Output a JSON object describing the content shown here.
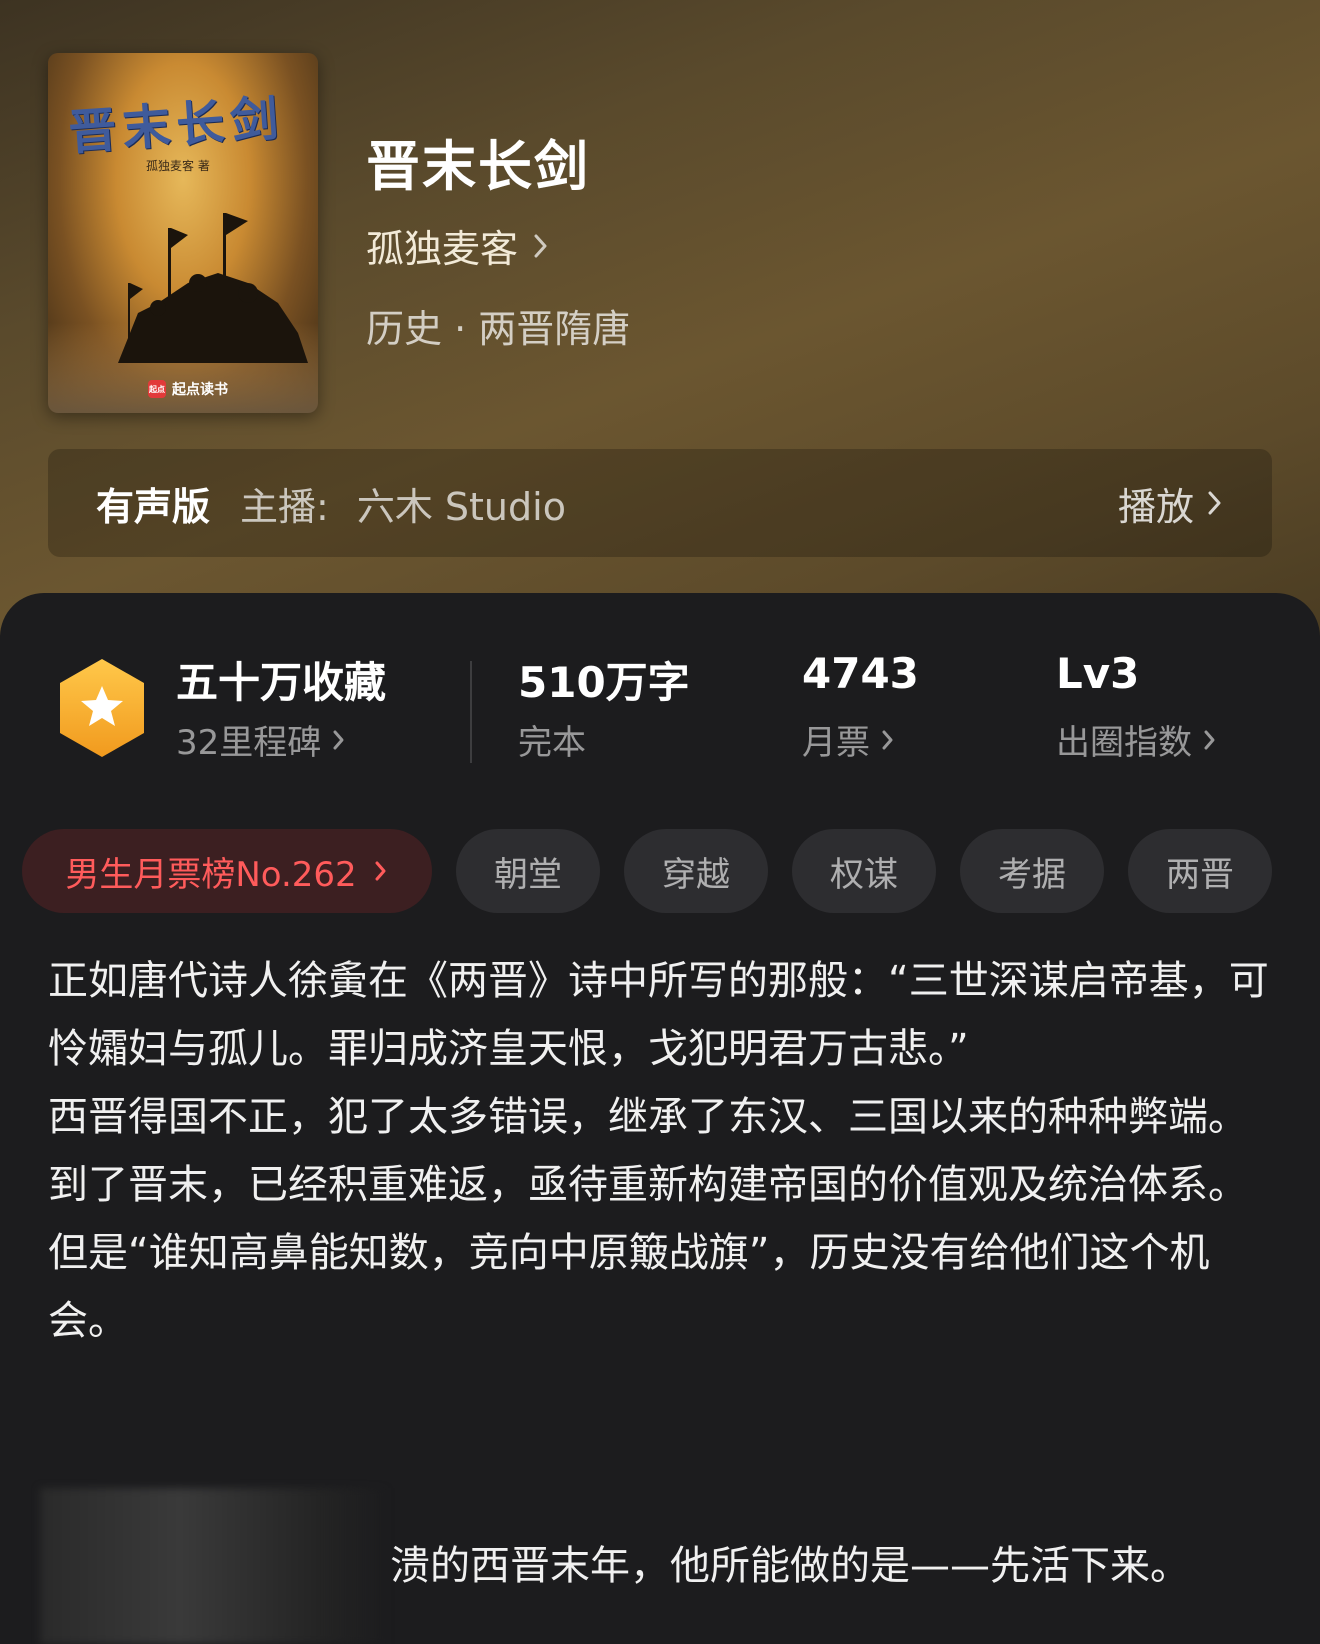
{
  "book": {
    "title": "晋末长剑",
    "author": "孤独麦客",
    "genre": "历史 · 两晋隋唐",
    "cover": {
      "title": "晋末长剑",
      "author_line": "孤独麦客 著",
      "publisher": "起点读书",
      "logo_mark": "起点"
    }
  },
  "audio": {
    "label": "有声版",
    "host_label": "主播:",
    "host": "六木 Studio",
    "play_label": "播放"
  },
  "stats": {
    "collect_title": "五十万收藏",
    "collect_sub": "32里程碑",
    "words": "510万字",
    "words_sub": "完本",
    "tickets": "4743",
    "tickets_sub": "月票",
    "level": "Lv3",
    "level_sub": "出圈指数"
  },
  "tags": {
    "rank": "男生月票榜No.262",
    "items": [
      "朝堂",
      "穿越",
      "权谋",
      "考据",
      "两晋"
    ]
  },
  "description": {
    "lines": [
      "正如唐代诗人徐夤在《两晋》诗中所写的那般：“三世深谋启帝基，可怜孀妇与孤儿。罪归成济皇天恨，戈犯明君万古悲。”",
      "西晋得国不正，犯了太多错误，继承了东汉、三国以来的种种弊端。",
      "到了晋末，已经积重难返，亟待重新构建帝国的价值观及统治体系。",
      "但是“谁知高鼻能知数，竞向中原簸战旗”，历史没有给他们这个机会。"
    ],
    "last_line": "溃的西晋末年，他所能做的是——先活下来。"
  },
  "colors": {
    "accent_red": "#ff5b5b",
    "badge_gold": "#f4a52a",
    "panel_bg": "#1c1c1e"
  },
  "icons": [
    "chevron-right-icon",
    "star-badge-icon"
  ]
}
